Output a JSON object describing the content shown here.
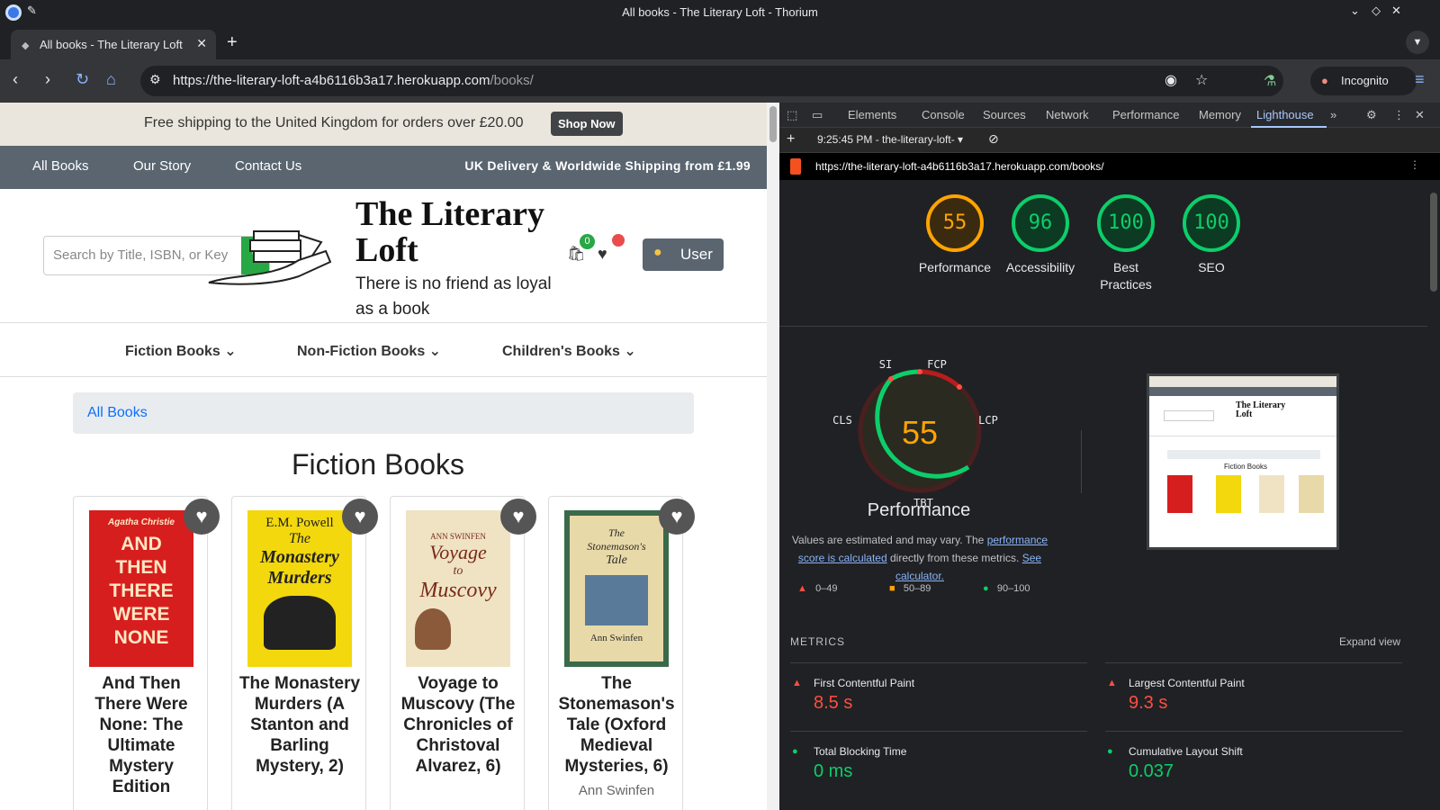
{
  "window": {
    "title": "All books - The Literary Loft - Thorium"
  },
  "tab": {
    "label": "All books - The Literary Loft"
  },
  "address": {
    "url_main": "https://the-literary-loft-a4b6116b3a17.herokuapp.com",
    "url_path": "/books/",
    "incognito": "Incognito"
  },
  "promo": {
    "text": "Free shipping to the United Kingdom for orders over £20.00",
    "button": "Shop Now"
  },
  "nav": {
    "items": [
      "All Books",
      "Our Story",
      "Contact Us"
    ],
    "shipping": "UK Delivery & Worldwide Shipping from £1.99"
  },
  "header": {
    "search_placeholder": "Search by Title, ISBN, or Key",
    "brand": "The Literary Loft",
    "tagline": "There is no friend as loyal as a book",
    "cart_count": "0",
    "user_label": "User"
  },
  "categories": [
    "Fiction Books",
    "Non-Fiction Books",
    "Children's Books"
  ],
  "breadcrumb": "All Books",
  "heading": "Fiction Books",
  "books": [
    {
      "title": "And Then There Were None: The Ultimate Mystery Edition",
      "author": "",
      "cover_lines": [
        "Agatha Christie",
        "AND",
        "THEN",
        "THERE",
        "WERE",
        "NONE"
      ],
      "cover_bg": "#d71e1e"
    },
    {
      "title": "The Monastery Murders (A Stanton and Barling Mystery, 2)",
      "author": "",
      "cover_lines": [
        "E.M. Powell",
        "The",
        "Monastery",
        "Murders"
      ],
      "cover_bg": "#f2d80d"
    },
    {
      "title": "Voyage to Muscovy (The Chronicles of Christoval Alvarez, 6)",
      "author": "",
      "cover_lines": [
        "ANN SWINFEN",
        "Voyage",
        "to",
        "Muscovy"
      ],
      "cover_bg": "#efe3c4"
    },
    {
      "title": "The Stonemason's Tale (Oxford Medieval Mysteries, 6)",
      "author": "Ann Swinfen",
      "cover_lines": [
        "The",
        "Stonemason's",
        "Tale",
        "Ann Swinfen"
      ],
      "cover_bg": "#e8d9a8"
    }
  ],
  "devtools": {
    "tabs": [
      "Elements",
      "Console",
      "Sources",
      "Network",
      "Performance",
      "Memory",
      "Lighthouse"
    ],
    "report_select": "9:25:45 PM - the-literary-loft-",
    "report_url": "https://the-literary-loft-a4b6116b3a17.herokuapp.com/books/"
  },
  "lighthouse": {
    "scores": [
      {
        "label": "Performance",
        "value": "55",
        "color": "#ffa400"
      },
      {
        "label": "Accessibility",
        "value": "96",
        "color": "#0cce6b"
      },
      {
        "label": "Best Practices",
        "value": "100",
        "color": "#0cce6b"
      },
      {
        "label": "SEO",
        "value": "100",
        "color": "#0cce6b"
      }
    ],
    "perf_big": "55",
    "perf_title": "Performance",
    "gauge_labels": {
      "si": "SI",
      "fcp": "FCP",
      "lcp": "LCP",
      "tbt": "TBT",
      "cls": "CLS"
    },
    "note_pre": "Values are estimated and may vary. The",
    "note_link1": "performance score is calculated",
    "note_mid": "directly from these metrics.",
    "note_link2": "See calculator.",
    "legend": [
      "0–49",
      "50–89",
      "90–100"
    ],
    "metrics_header": "METRICS",
    "expand": "Expand view",
    "metrics": [
      {
        "label": "First Contentful Paint",
        "value": "8.5 s",
        "status": "red"
      },
      {
        "label": "Largest Contentful Paint",
        "value": "9.3 s",
        "status": "red"
      },
      {
        "label": "Total Blocking Time",
        "value": "0 ms",
        "status": "green"
      },
      {
        "label": "Cumulative Layout Shift",
        "value": "0.037",
        "status": "green"
      }
    ]
  }
}
